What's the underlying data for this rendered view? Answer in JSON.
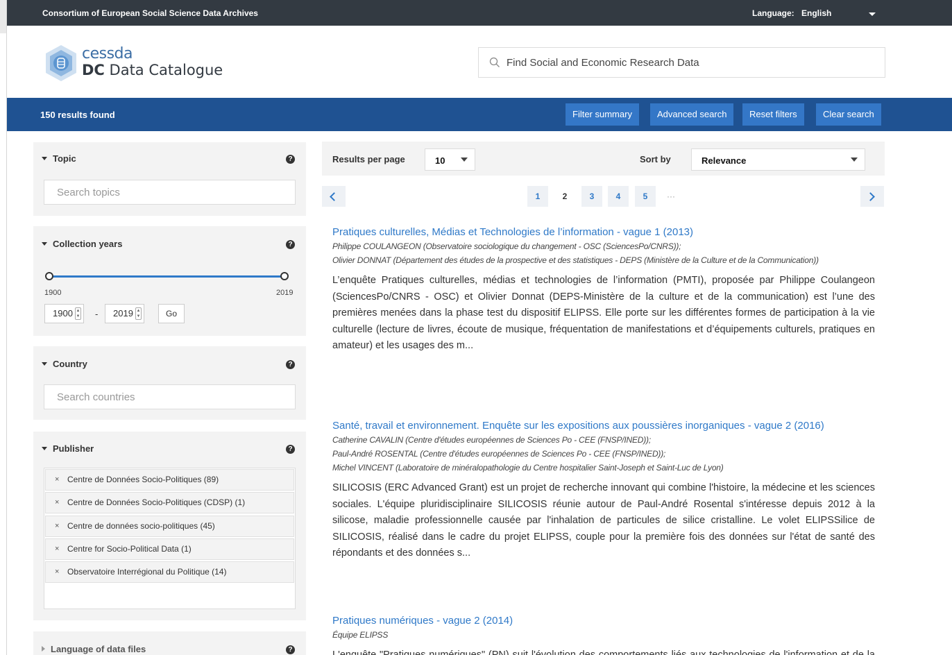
{
  "topbar": {
    "brand": "Consortium of European Social Science Data Archives",
    "language_label": "Language:",
    "language_value": "English"
  },
  "header": {
    "logo_top": "cessda",
    "logo_bold": "DC",
    "logo_rest": "Data Catalogue",
    "search_placeholder": "Find Social and Economic Research Data"
  },
  "results_bar": {
    "count": "150 results found",
    "buttons": [
      "Filter summary",
      "Advanced search",
      "Reset filters",
      "Clear search"
    ]
  },
  "facets": {
    "topic": {
      "label": "Topic",
      "placeholder": "Search topics"
    },
    "years": {
      "label": "Collection years",
      "min": "1900",
      "max": "2019",
      "from": "1900",
      "to": "2019",
      "dash": "-",
      "go": "Go"
    },
    "country": {
      "label": "Country",
      "placeholder": "Search countries"
    },
    "publisher": {
      "label": "Publisher",
      "items": [
        "Centre de Données Socio-Politiques (89)",
        "Centre de Données Socio-Politiques (CDSP) (1)",
        "Centre de données socio-politiques (45)",
        "Centre for Socio-Political Data (1)",
        "Observatoire Interrégional du Politique (14)"
      ],
      "remove_glyph": "×"
    },
    "language": {
      "label": "Language of data files"
    },
    "help_glyph": "?"
  },
  "controls": {
    "results_per_page_label": "Results per page",
    "results_per_page_value": "10",
    "sort_by_label": "Sort by",
    "sort_by_value": "Relevance"
  },
  "pagination": {
    "pages": [
      "1",
      "2",
      "3",
      "4",
      "5"
    ],
    "current_page": "2",
    "ellipsis": "···"
  },
  "results": [
    {
      "title": "Pratiques culturelles, Médias et Technologies de l’information - vague 1 (2013)",
      "authors": [
        "Philippe COULANGEON (Observatoire sociologique du changement - OSC (SciencesPo/CNRS));",
        "Olivier DONNAT (Département des études de la prospective et des statistiques - DEPS (Ministère de la Culture et de la Communication))"
      ],
      "description": "L’enquête Pratiques culturelles, médias et technologies de l’information (PMTI), proposée par Philippe Coulangeon (SciencesPo/CNRS - OSC) et Olivier Donnat (DEPS-Ministère de la culture et de la communication) est l’une des premières menées dans la phase test du dispositif ELIPSS. Elle porte sur les différentes formes de participation à la vie culturelle (lecture de livres, écoute de musique, fréquentation de manifestations et d’équipements culturels, pratiques en amateur) et les usages des m..."
    },
    {
      "title": "Santé, travail et environnement. Enquête sur les expositions aux poussières inorganiques - vague 2 (2016)",
      "authors": [
        "Catherine CAVALIN (Centre d'études européennes de Sciences Po - CEE (FNSP/INED));",
        "Paul-André ROSENTAL (Centre d'études européennes de Sciences Po - CEE (FNSP/INED));",
        "Michel VINCENT (Laboratoire de minéralopathologie du Centre hospitalier Saint-Joseph et Saint-Luc de Lyon)"
      ],
      "description": "SILICOSIS (ERC Advanced Grant) est un projet de recherche innovant qui combine l'histoire, la médecine et les sciences sociales. L'équipe pluridisciplinaire SILICOSIS réunie autour de Paul-André Rosental s'intéresse depuis 2012 à la silicose, maladie professionnelle causée par l'inhalation de particules de silice cristalline. Le volet ELIPSSilice de SILICOSIS, réalisé dans le cadre du projet ELIPSS, couple pour la première fois des données sur l'état de santé des répondants et des données s..."
    },
    {
      "title": "Pratiques numériques - vague 2 (2014)",
      "authors": [
        "Équipe ELIPSS"
      ],
      "description": "L'enquête \"Pratiques numériques\" (PN) suit l'évolution des comportements liés aux technologies de l'information et de la communication..."
    }
  ],
  "colors": {
    "topbar": "#333a42",
    "results_bar": "#1f5292",
    "button": "#3477c7",
    "link": "#2f79c8"
  }
}
